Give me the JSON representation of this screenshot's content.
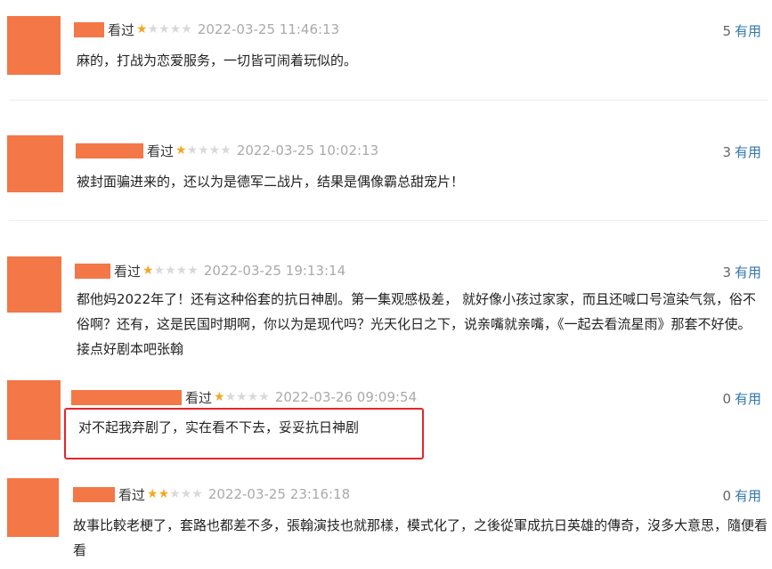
{
  "reviews": [
    {
      "status": "看过",
      "rating": 1,
      "time": "2022-03-25 11:46:13",
      "helpful_count": "5",
      "helpful_label": "有用",
      "content": "麻的，打战为恋爱服务，一切皆可闹着玩似的。"
    },
    {
      "status": "看过",
      "rating": 1,
      "time": "2022-03-25 10:02:13",
      "helpful_count": "3",
      "helpful_label": "有用",
      "content": "被封面骗进来的，还以为是德军二战片，结果是偶像霸总甜宠片！"
    },
    {
      "status": "看过",
      "rating": 1,
      "time": "2022-03-25 19:13:14",
      "helpful_count": "3",
      "helpful_label": "有用",
      "content": "都他妈2022年了！还有这种俗套的抗日神剧。第一集观感极差， 就好像小孩过家家，而且还喊口号渲染气氛，俗不俗啊？还有，这是民国时期啊，你以为是现代吗？光天化日之下，说亲嘴就亲嘴，《一起去看流星雨》那套不好使。接点好剧本吧张翰"
    },
    {
      "status": "看过",
      "rating": 1,
      "time": "2022-03-26 09:09:54",
      "helpful_count": "0",
      "helpful_label": "有用",
      "content": "对不起我弃剧了，实在看不下去，妥妥抗日神剧"
    },
    {
      "status": "看过",
      "rating": 2,
      "time": "2022-03-25 23:16:18",
      "helpful_count": "0",
      "helpful_label": "有用",
      "content": "故事比較老梗了，套路也都差不多，張翰演技也就那樣，模式化了，之後從軍成抗日英雄的傳奇，沒多大意思，隨便看看"
    }
  ],
  "colors": {
    "avatar": "#f37747",
    "star_on": "#f5a623",
    "star_off": "#d9d9d9",
    "link": "#3377aa",
    "highlight": "#e4262b"
  }
}
